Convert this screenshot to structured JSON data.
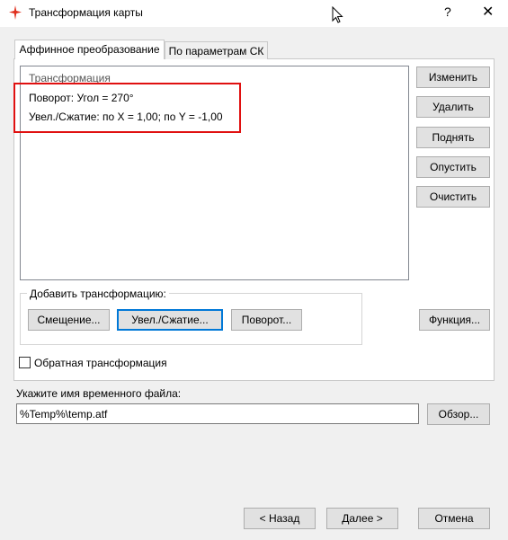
{
  "window": {
    "title": "Трансформация карты",
    "help": "?",
    "close": "✕"
  },
  "tabs": [
    {
      "label": "Аффинное преобразование",
      "active": true
    },
    {
      "label": "По параметрам СК",
      "active": false
    }
  ],
  "transform_list": {
    "header": "Трансформация",
    "items": [
      "Поворот: Угол = 270°",
      "Увел./Сжатие: по X = 1,00; по Y = -1,00"
    ]
  },
  "side_buttons": {
    "change": "Изменить",
    "delete": "Удалить",
    "up": "Поднять",
    "down": "Опустить",
    "clear": "Очистить",
    "function": "Функция..."
  },
  "add_group": {
    "label": "Добавить трансформацию:",
    "shift": "Смещение...",
    "scale": "Увел./Сжатие...",
    "rotate": "Поворот..."
  },
  "inverse": {
    "label": "Обратная трансформация",
    "checked": false
  },
  "temp_file": {
    "label": "Укажите имя временного файла:",
    "value": "%Temp%\\temp.atf",
    "browse": "Обзор..."
  },
  "footer": {
    "back": "< Назад",
    "next": "Далее >",
    "cancel": "Отмена"
  },
  "colors": {
    "highlight_border": "#e01010",
    "focus_border": "#0078d7",
    "app_icon": "#e0301e"
  }
}
